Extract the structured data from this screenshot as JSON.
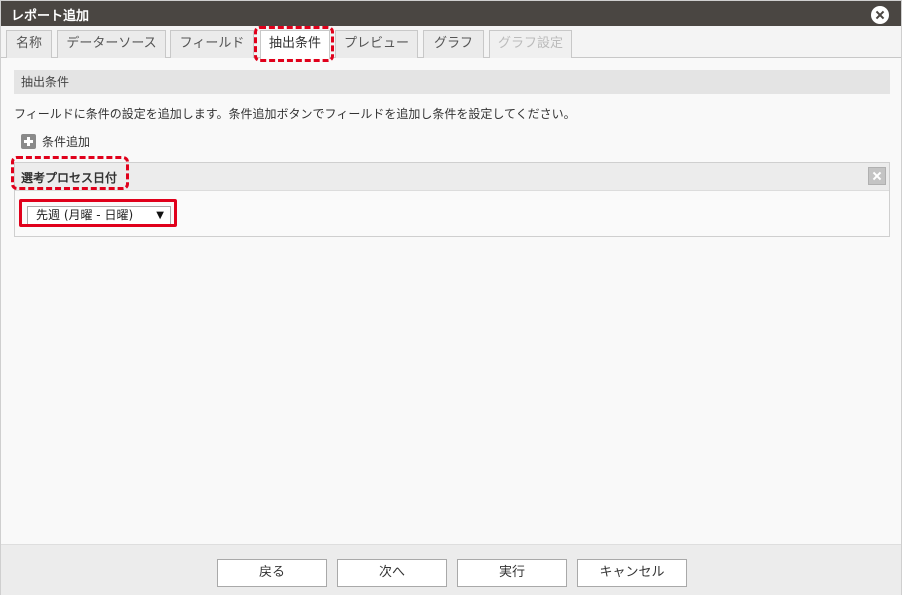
{
  "dialog": {
    "title": "レポート追加"
  },
  "tabs": [
    {
      "label": "名称"
    },
    {
      "label": "データーソース"
    },
    {
      "label": "フィールド"
    },
    {
      "label": "抽出条件"
    },
    {
      "label": "プレビュー"
    },
    {
      "label": "グラフ"
    },
    {
      "label": "グラフ設定"
    }
  ],
  "active_tab": "抽出条件",
  "section": {
    "header": "抽出条件",
    "description": "フィールドに条件の設定を追加します。条件追加ボタンでフィールドを追加し条件を設定してください。",
    "add_condition_label": "条件追加"
  },
  "condition": {
    "title": "選考プロセス日付",
    "selected_option": "先週 (月曜 - 日曜)"
  },
  "footer": {
    "back_label": "戻る",
    "next_label": "次へ",
    "run_label": "実行",
    "cancel_label": "キャンセル"
  },
  "colors": {
    "titlebar": "#4a4642",
    "highlight": "#e0001b"
  }
}
